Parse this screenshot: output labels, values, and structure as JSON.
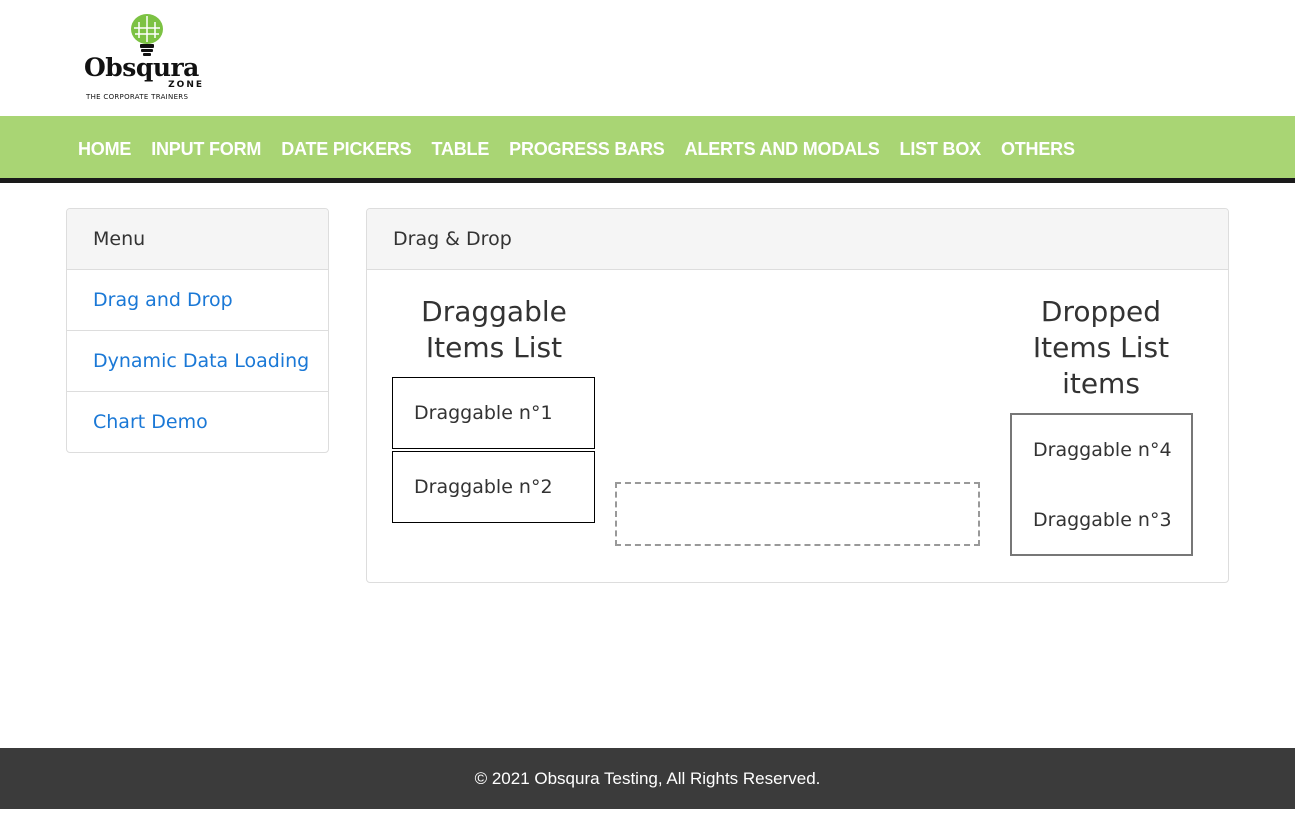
{
  "logo": {
    "name": "Obsqura",
    "sub": "ZONE",
    "tagline": "THE CORPORATE TRAINERS"
  },
  "nav": {
    "items": [
      "HOME",
      "INPUT FORM",
      "DATE PICKERS",
      "TABLE",
      "PROGRESS BARS",
      "ALERTS AND MODALS",
      "LIST BOX",
      "OTHERS"
    ]
  },
  "sidebar": {
    "heading": "Menu",
    "items": [
      "Drag and Drop",
      "Dynamic Data Loading",
      "Chart Demo"
    ]
  },
  "main": {
    "heading": "Drag & Drop",
    "draggable_title": "Draggable Items List",
    "draggable_items": [
      "Draggable n°1",
      "Draggable n°2"
    ],
    "dropped_title": "Dropped Items List items",
    "dropped_items": [
      "Draggable n°4",
      "Draggable n°3"
    ]
  },
  "footer": {
    "text": "© 2021 Obsqura Testing, All Rights Reserved."
  },
  "colors": {
    "nav_bg": "#a9d574",
    "link": "#1a78d6",
    "footer_bg": "#3b3b3b"
  }
}
